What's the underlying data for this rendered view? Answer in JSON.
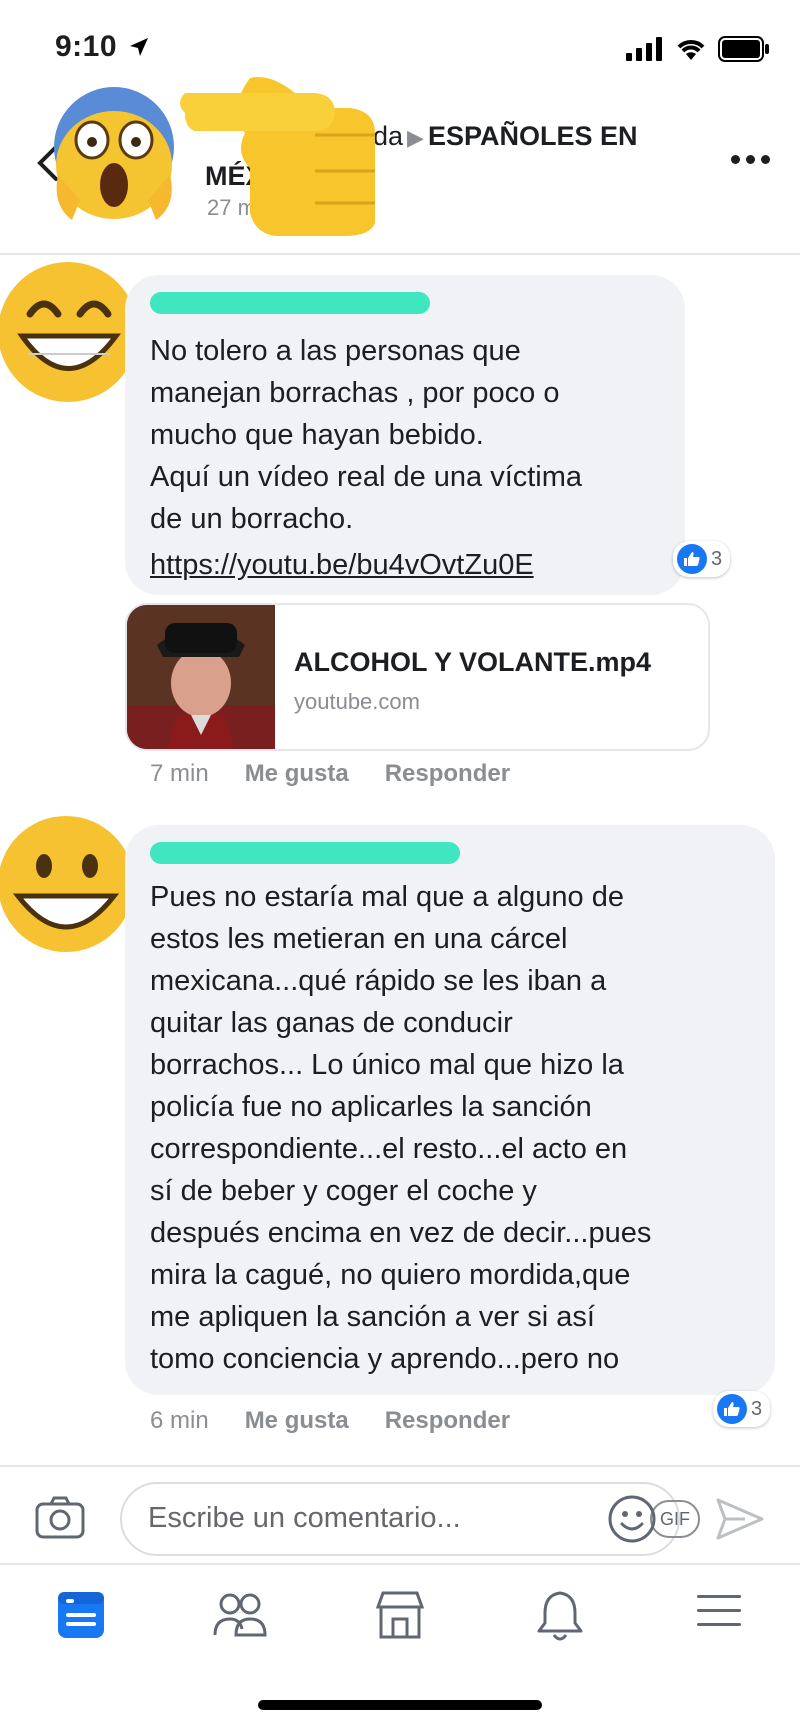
{
  "status_bar": {
    "time": "9:10"
  },
  "post_header": {
    "author_fragment": "da",
    "group_name": "ESPAÑOLES EN",
    "group_name_line2": "MÉX",
    "timestamp_fragment": "27 mi"
  },
  "comments": [
    {
      "text": "No tolero a las personas que\nmanejan borrachas , por poco o\nmucho que hayan bebido.\nAquí un vídeo real de una víctima\nde un borracho.",
      "link": "https://youtu.be/bu4vOvtZu0E",
      "reaction_count": "3",
      "link_preview": {
        "title": "ALCOHOL Y VOLANTE.mp4",
        "domain": "youtube.com"
      },
      "time": "7 min",
      "like_label": "Me gusta",
      "reply_label": "Responder"
    },
    {
      "text": "Pues no estaría mal que a alguno de\nestos les metieran en una cárcel\nmexicana...qué rápido se les iban a\nquitar las ganas de conducir\nborrachos... Lo único mal que hizo la\npolicía fue no aplicarles la sanción\ncorrespondiente...el resto...el acto en\nsí de beber y coger el coche y\ndespués encima en vez de decir...pues\nmira la cagué, no quiero mordida,que\nme apliquen la sanción a ver si así\ntomo conciencia y aprendo...pero no",
      "reaction_count": "3",
      "time": "6 min",
      "like_label": "Me gusta",
      "reply_label": "Responder"
    }
  ],
  "composer": {
    "placeholder": "Escribe un comentario...",
    "gif_label": "GIF"
  },
  "tabs": [
    "news-feed-icon",
    "groups-icon",
    "marketplace-icon",
    "notifications-icon",
    "menu-icon"
  ],
  "colors": {
    "accent": "#1877f2",
    "bubble": "#f0f2f5",
    "muted": "#8a8d91",
    "redaction": "#3fe6c0"
  }
}
